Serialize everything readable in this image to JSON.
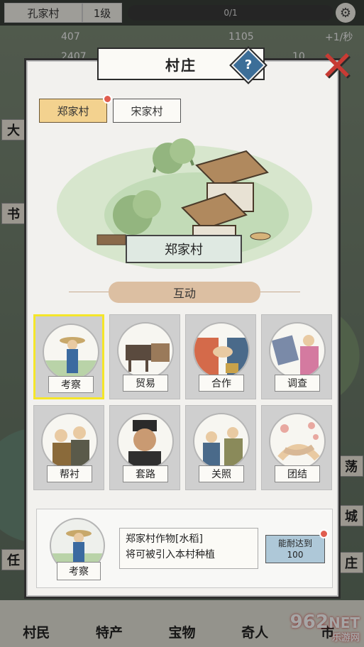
{
  "topbar": {
    "village_name": "孔家村",
    "level": "1级",
    "progress": "0/1",
    "settings_icon": "gear-icon"
  },
  "resources": {
    "stat1": "407",
    "stat2": "1105",
    "rate": "+1/秒",
    "stat3": "2407",
    "stat4": "10"
  },
  "dialog": {
    "title": "村庄",
    "help_label": "?",
    "close_label": "✕",
    "tabs": [
      {
        "label": "郑家村",
        "active": true,
        "badge": true
      },
      {
        "label": "宋家村",
        "active": false,
        "badge": false
      }
    ],
    "scene_label": "郑家村",
    "section_title": "互动",
    "actions": [
      {
        "label": "考察",
        "selected": true
      },
      {
        "label": "贸易",
        "selected": false
      },
      {
        "label": "合作",
        "selected": false
      },
      {
        "label": "调查",
        "selected": false
      },
      {
        "label": "帮衬",
        "selected": false
      },
      {
        "label": "套路",
        "selected": false
      },
      {
        "label": "关照",
        "selected": false
      },
      {
        "label": "团结",
        "selected": false
      }
    ],
    "info": {
      "portrait_label": "考察",
      "line1": "郑家村作物[水稻]",
      "line2": "将可被引入本村种植",
      "button_line1": "能耐达到",
      "button_line2": "100"
    }
  },
  "bottom_nav": [
    "村民",
    "特产",
    "宝物",
    "奇人"
  ],
  "side_labels": {
    "left_top": "大",
    "left_mid": "书",
    "left_ren": "任",
    "left_shi": "市",
    "right_dang": "荡",
    "right_cheng": "城",
    "right_zhuang": "庄"
  },
  "watermark": {
    "main": "962",
    "net": "NET",
    "sub": "乐游网"
  },
  "colors": {
    "accent_red": "#c83b34",
    "tab_active": "#f3d28f",
    "selected_border": "#f5e629",
    "help_blue": "#3c6e98",
    "info_button": "#aec8d8"
  }
}
